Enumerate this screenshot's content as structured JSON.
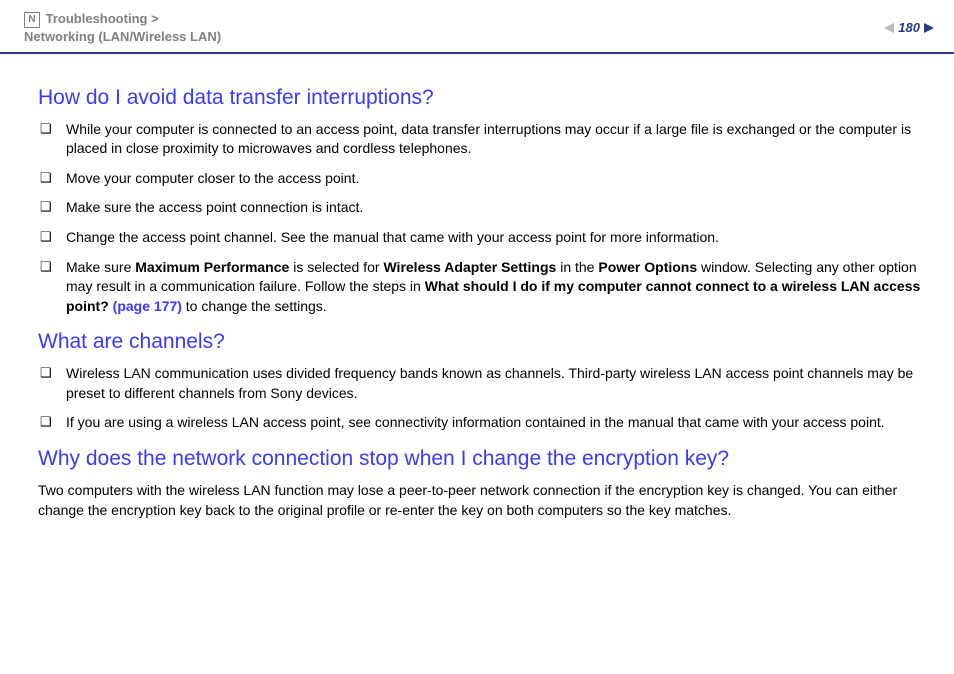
{
  "header": {
    "n_icon": "N",
    "breadcrumb_line1": "Troubleshooting >",
    "breadcrumb_line2": "Networking (LAN/Wireless LAN)",
    "page_number": "180"
  },
  "sections": [
    {
      "heading": "How do I avoid data transfer interruptions?",
      "items": [
        {
          "text": "While your computer is connected to an access point, data transfer interruptions may occur if a large file is exchanged or the computer is placed in close proximity to microwaves and cordless telephones."
        },
        {
          "text": "Move your computer closer to the access point."
        },
        {
          "text": "Make sure the access point connection is intact."
        },
        {
          "text": "Change the access point channel. See the manual that came with your access point for more information."
        },
        {
          "t1": "Make sure ",
          "b1": "Maximum Performance",
          "t2": " is selected for ",
          "b2": "Wireless Adapter Settings",
          "t3": " in the ",
          "b3": "Power Options",
          "t4": " window. Selecting any other option may result in a communication failure. Follow the steps in ",
          "b4": "What should I do if my computer cannot connect to a wireless LAN access point? ",
          "l1": "(page 177)",
          "t5": " to change the settings."
        }
      ]
    },
    {
      "heading": "What are channels?",
      "items": [
        {
          "text": "Wireless LAN communication uses divided frequency bands known as channels. Third-party wireless LAN access point channels may be preset to different channels from Sony devices."
        },
        {
          "text": "If you are using a wireless LAN access point, see connectivity information contained in the manual that came with your access point."
        }
      ]
    },
    {
      "heading": "Why does the network connection stop when I change the encryption key?",
      "paragraph": "Two computers with the wireless LAN function may lose a peer-to-peer network connection if the encryption key is changed. You can either change the encryption key back to the original profile or re-enter the key on both computers so the key matches."
    }
  ]
}
